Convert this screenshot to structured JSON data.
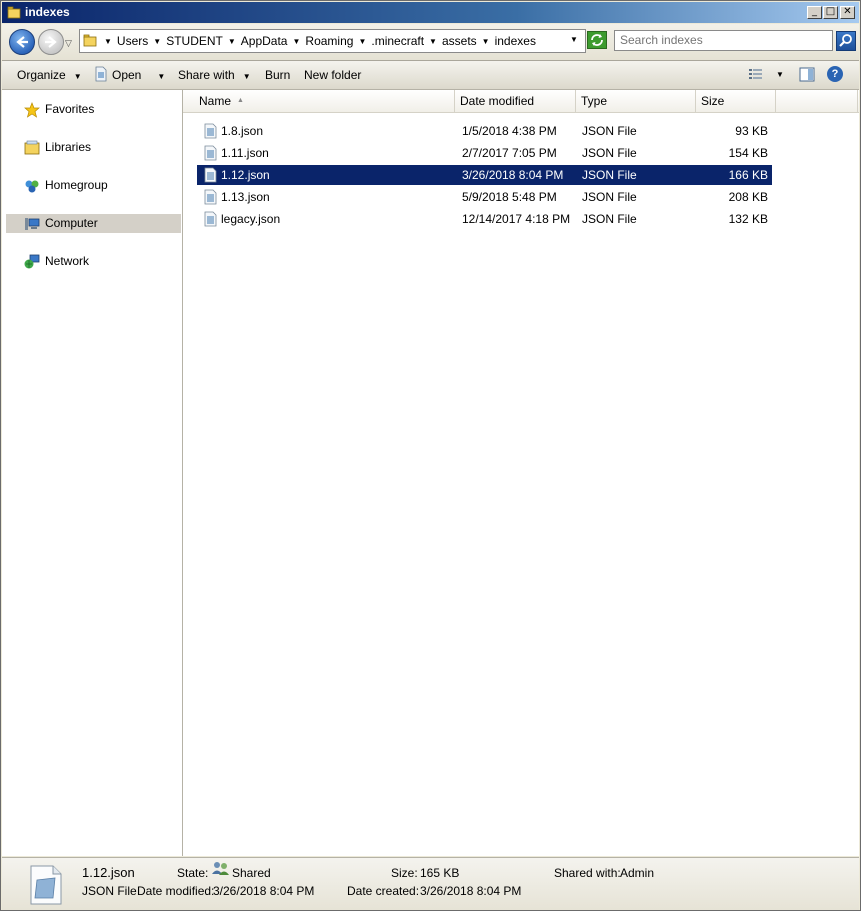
{
  "window": {
    "title": "indexes",
    "buttons": {
      "minimize": "_",
      "maximize": "□",
      "close": "✕"
    }
  },
  "address": {
    "crumbs": [
      "Users",
      "STUDENT",
      "AppData",
      "Roaming",
      ".minecraft",
      "assets",
      "indexes"
    ],
    "search_placeholder": "Search indexes"
  },
  "toolbar": {
    "organize": "Organize",
    "open": "Open",
    "share_with": "Share with",
    "burn": "Burn",
    "new_folder": "New folder",
    "help": "?"
  },
  "nav": {
    "items": [
      "Favorites",
      "Libraries",
      "Homegroup",
      "Computer",
      "Network"
    ],
    "selected": "Computer"
  },
  "columns": {
    "name": "Name",
    "date": "Date modified",
    "type": "Type",
    "size": "Size"
  },
  "files": [
    {
      "name": "1.8.json",
      "date": "1/5/2018 4:38 PM",
      "type": "JSON File",
      "size": "93 KB"
    },
    {
      "name": "1.11.json",
      "date": "2/7/2017 7:05 PM",
      "type": "JSON File",
      "size": "154 KB"
    },
    {
      "name": "1.12.json",
      "date": "3/26/2018 8:04 PM",
      "type": "JSON File",
      "size": "166 KB"
    },
    {
      "name": "1.13.json",
      "date": "5/9/2018 5:48 PM",
      "type": "JSON File",
      "size": "208 KB"
    },
    {
      "name": "legacy.json",
      "date": "12/14/2017 4:18 PM",
      "type": "JSON File",
      "size": "132 KB"
    }
  ],
  "selected_file": "1.12.json",
  "details": {
    "name": "1.12.json",
    "type": "JSON File",
    "state_label": "State:",
    "state_value": "Shared",
    "size_label": "Size:",
    "size_value": "165 KB",
    "shared_label": "Shared with:",
    "shared_value": "Admin",
    "modified_label": "Date modified:",
    "modified_value": "3/26/2018 8:04 PM",
    "created_label": "Date created:",
    "created_value": "3/26/2018 8:04 PM"
  },
  "colors": {
    "selection": "#0a246a",
    "title_start": "#0a246a",
    "title_end": "#a6caf0"
  }
}
